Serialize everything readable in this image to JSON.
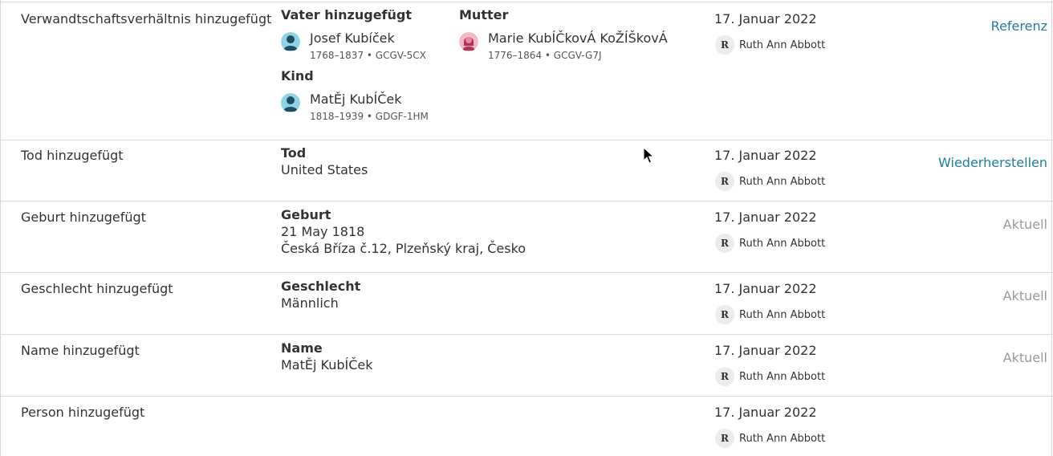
{
  "rows": [
    {
      "type": "Verwandtschaftsverhältnis hinzugefügt",
      "father_label": "Vater hinzugefügt",
      "father": {
        "name": "Josef Kubíček",
        "meta": "1768–1837 • GCGV-5CX",
        "icon": "male-person-icon"
      },
      "mother_label": "Mutter",
      "mother": {
        "name": "Marie KubÍČkovÁ KoŽÍŠkovÁ",
        "meta": "1776–1864 • GCGV-G7J",
        "icon": "female-person-icon"
      },
      "child_label": "Kind",
      "child": {
        "name": "MatĚj KubÍČek",
        "meta": "1818–1939 • GDGF-1HM",
        "icon": "male-person-icon"
      },
      "date": "17. Januar 2022",
      "user": "Ruth Ann Abbott",
      "user_initial": "R",
      "action": "Referenz"
    },
    {
      "type": "Tod hinzugefügt",
      "label": "Tod",
      "line1": "United States",
      "date": "17. Januar 2022",
      "user": "Ruth Ann Abbott",
      "user_initial": "R",
      "action": "Wiederherstellen"
    },
    {
      "type": "Geburt hinzugefügt",
      "label": "Geburt",
      "line1": "21 May 1818",
      "line2": "Česká Bříza č.12, Plzeňský kraj, Česko",
      "date": "17. Januar 2022",
      "user": "Ruth Ann Abbott",
      "user_initial": "R",
      "action": "Aktuell"
    },
    {
      "type": "Geschlecht hinzugefügt",
      "label": "Geschlecht",
      "line1": "Männlich",
      "date": "17. Januar 2022",
      "user": "Ruth Ann Abbott",
      "user_initial": "R",
      "action": "Aktuell"
    },
    {
      "type": "Name hinzugefügt",
      "label": "Name",
      "line1": "MatĚj KubÍČek",
      "date": "17. Januar 2022",
      "user": "Ruth Ann Abbott",
      "user_initial": "R",
      "action": "Aktuell"
    },
    {
      "type": "Person hinzugefügt",
      "date": "17. Januar 2022",
      "user": "Ruth Ann Abbott",
      "user_initial": "R"
    }
  ],
  "colors": {
    "link": "#1f7e9b",
    "muted": "#9a9a9a",
    "male_avatar": "#8fd3e6",
    "female_avatar": "#f2b8c6"
  }
}
